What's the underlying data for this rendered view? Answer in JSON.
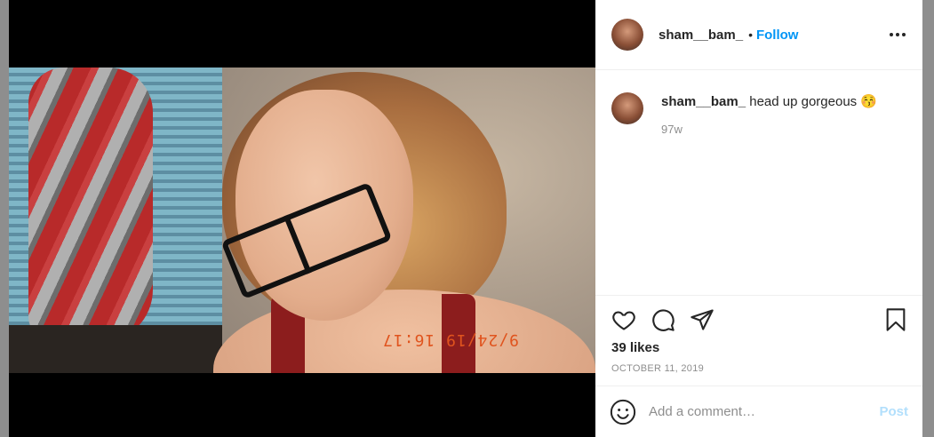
{
  "post": {
    "username": "sham__bam_",
    "separator": "•",
    "follow_label": "Follow",
    "more_icon": "more-options-icon",
    "photo_timestamp": "9/24/19 16:17",
    "caption": {
      "username": "sham__bam_",
      "text": "head up gorgeous 😚",
      "age": "97w"
    },
    "likes": "39 likes",
    "date": "OCTOBER 11, 2019"
  },
  "actions": {
    "icons": [
      "heart-icon",
      "comment-icon",
      "share-icon",
      "bookmark-icon"
    ]
  },
  "comment_box": {
    "placeholder": "Add a comment…",
    "post_label": "Post",
    "emoji_icon": "emoji-icon"
  },
  "colors": {
    "link": "#0095f6",
    "post_disabled": "#b2dffc",
    "text": "#262626",
    "muted": "#8e8e8e"
  }
}
